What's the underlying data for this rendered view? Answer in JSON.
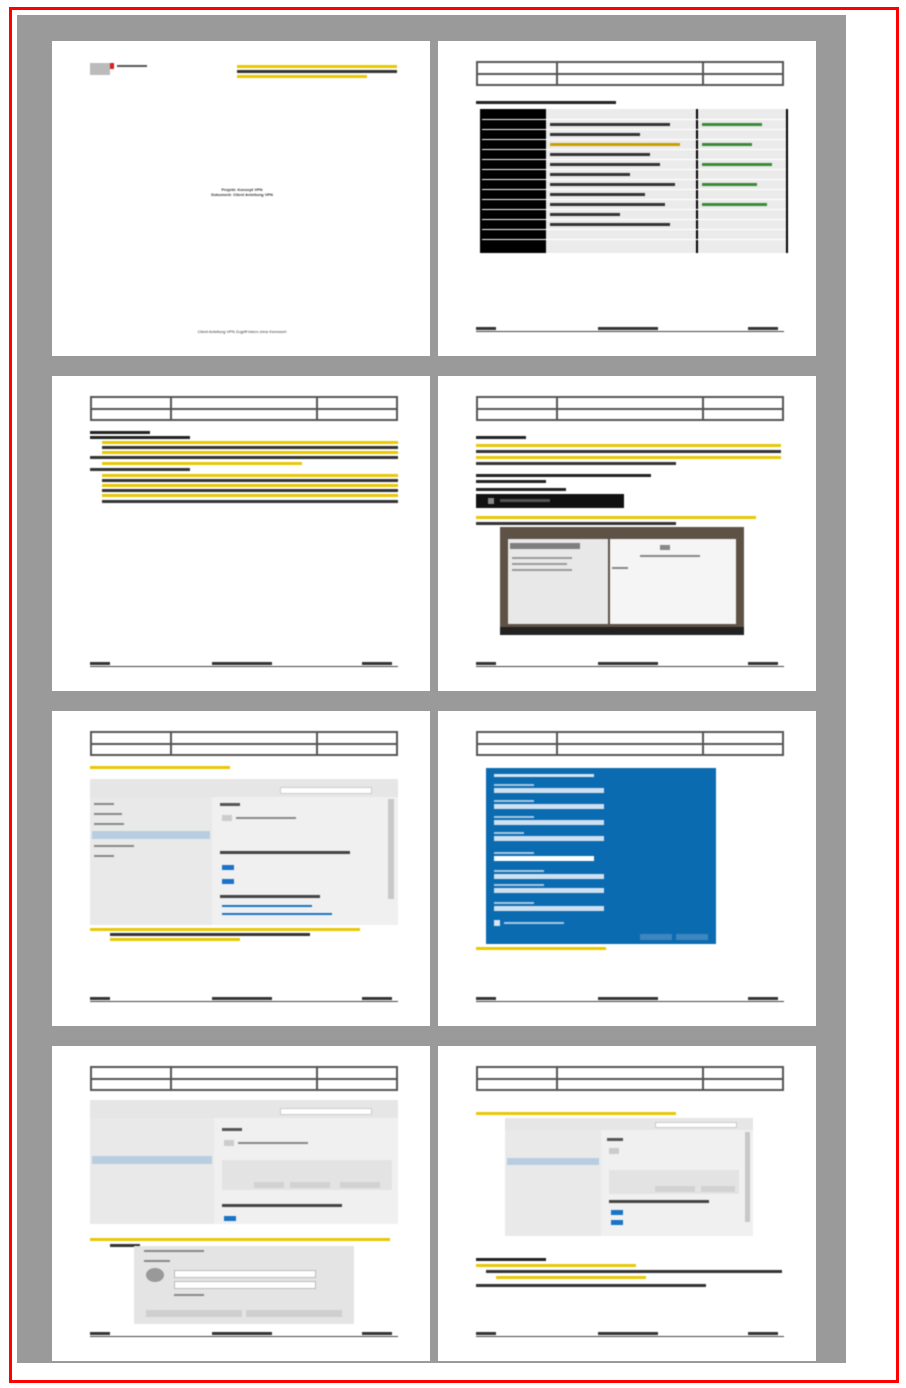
{
  "document": {
    "pages": [
      {
        "cover_title_line1": "Projekt: Konzept VPN",
        "cover_title_line2": "Dokument: Client Anleitung VPN",
        "cover_footer": "Client Anleitung VPN Zugriff intern ohne Kennwort"
      },
      {},
      {},
      {},
      {},
      {},
      {},
      {}
    ]
  },
  "colors": {
    "border": "#ff0000",
    "background": "#9a9a9a",
    "page": "#ffffff",
    "dialog_blue": "#0b6bb0"
  }
}
